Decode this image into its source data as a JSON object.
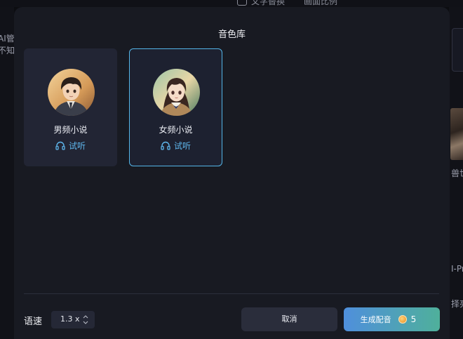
{
  "background": {
    "top_items": [
      "文字替换",
      "画面比例"
    ],
    "left_texts": [
      "AI管",
      "不知"
    ],
    "right_texts": [
      "兽世",
      "I-Pr",
      "择亮"
    ]
  },
  "modal": {
    "title": "音色库",
    "voices": [
      {
        "name": "男频小说",
        "listen_label": "试听",
        "selected": false
      },
      {
        "name": "女频小说",
        "listen_label": "试听",
        "selected": true
      }
    ],
    "speed": {
      "label": "语速",
      "value": "1.3 x"
    },
    "buttons": {
      "cancel": "取消",
      "generate": "生成配音",
      "cost": "5"
    }
  },
  "colors": {
    "accent": "#54b5e8",
    "listen": "#5eb6ec",
    "modal_bg": "#181a22",
    "card_bg": "#222534",
    "generate_gradient_start": "#4f8fdc",
    "generate_gradient_end": "#4fb09b"
  },
  "icons": [
    "headphones-icon",
    "coin-icon",
    "stepper-arrows-icon",
    "replace-icon"
  ]
}
